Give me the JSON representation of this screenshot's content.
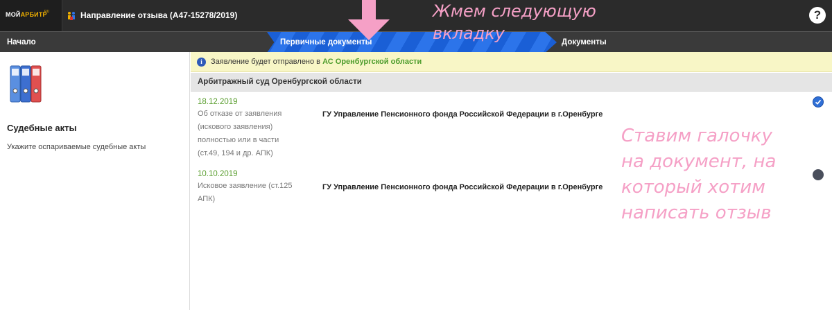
{
  "app": {
    "logo": {
      "brand_part1": "МОЙ",
      "brand_part2": "АРБИТР",
      "brand_suffix": "RU"
    },
    "title": "Направление отзыва  (А47-15278/2019)",
    "help_label": "?",
    "title_icon": "people-icon"
  },
  "steps": {
    "start": "Начало",
    "active": "Первичные документы",
    "documents": "Документы"
  },
  "sidebar": {
    "icon": "binders-icon",
    "title": "Судебные акты",
    "subtitle": "Укажите оспариваемые судебные акты"
  },
  "info": {
    "text": "Заявление будет отправлено в ",
    "court": "АС Оренбургской области"
  },
  "court_header": "Арбитражный суд Оренбургской области",
  "documents": [
    {
      "date": "18.12.2019",
      "desc_lines": [
        "Об отказе от заявления",
        "(искового заявления)",
        "полностью или в части",
        "(ст.49, 194 и др. АПК)"
      ],
      "party": "ГУ Управление Пенсионного фонда Российской Федерации в г.Оренбурге",
      "checked": true
    },
    {
      "date": "10.10.2019",
      "desc_lines": [
        "Исковое заявление (ст.125",
        "АПК)"
      ],
      "party": "ГУ Управление Пенсионного фонда Российской Федерации в г.Оренбурге",
      "checked": false
    }
  ],
  "annotations": {
    "top_lines": [
      "Жмем следующую",
      "вкладку"
    ],
    "right_lines": [
      "Ставим галочку",
      "на документ, на",
      "который хотим",
      "написать отзыв"
    ]
  },
  "colors": {
    "accent_active_step": "#1a5fd6",
    "court_green": "#4a9b2a",
    "annotation_pink": "#f5a0c6",
    "info_bg": "#f8f6c6"
  }
}
